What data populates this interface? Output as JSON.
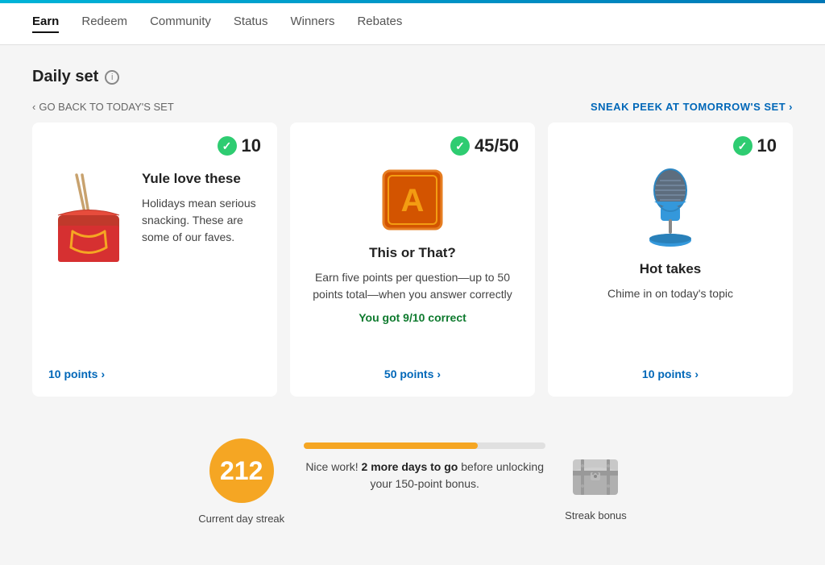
{
  "topbar": {
    "gradient_start": "#00b4d8",
    "gradient_end": "#0077b6"
  },
  "nav": {
    "items": [
      {
        "label": "Earn",
        "active": true
      },
      {
        "label": "Redeem",
        "active": false
      },
      {
        "label": "Community",
        "active": false
      },
      {
        "label": "Status",
        "active": false
      },
      {
        "label": "Winners",
        "active": false
      },
      {
        "label": "Rebates",
        "active": false
      }
    ]
  },
  "page": {
    "title": "Daily set",
    "back_link": "GO BACK TO TODAY'S SET",
    "sneak_peek": "SNEAK PEEK AT TOMORROW'S SET"
  },
  "cards": [
    {
      "score": "10",
      "title": "Yule love these",
      "description": "Holidays mean serious snacking. These are some of our faves.",
      "points_label": "10 points",
      "correct_text": "",
      "image_type": "takeout"
    },
    {
      "score": "45/50",
      "title": "This or That?",
      "description": "Earn five points per question—up to 50 points total—when you answer correctly",
      "points_label": "50 points",
      "correct_text": "You got 9/10 correct",
      "image_type": "alphabet"
    },
    {
      "score": "10",
      "title": "Hot takes",
      "description": "Chime in on today's topic",
      "points_label": "10 points",
      "correct_text": "",
      "image_type": "microphone"
    }
  ],
  "streak": {
    "number": "212",
    "current_label": "Current day streak",
    "message_part1": "Nice work! ",
    "message_bold": "2 more days to go",
    "message_part2": " before unlocking your 150-point bonus.",
    "bar_fill_percent": 72,
    "bonus_label": "Streak bonus"
  }
}
